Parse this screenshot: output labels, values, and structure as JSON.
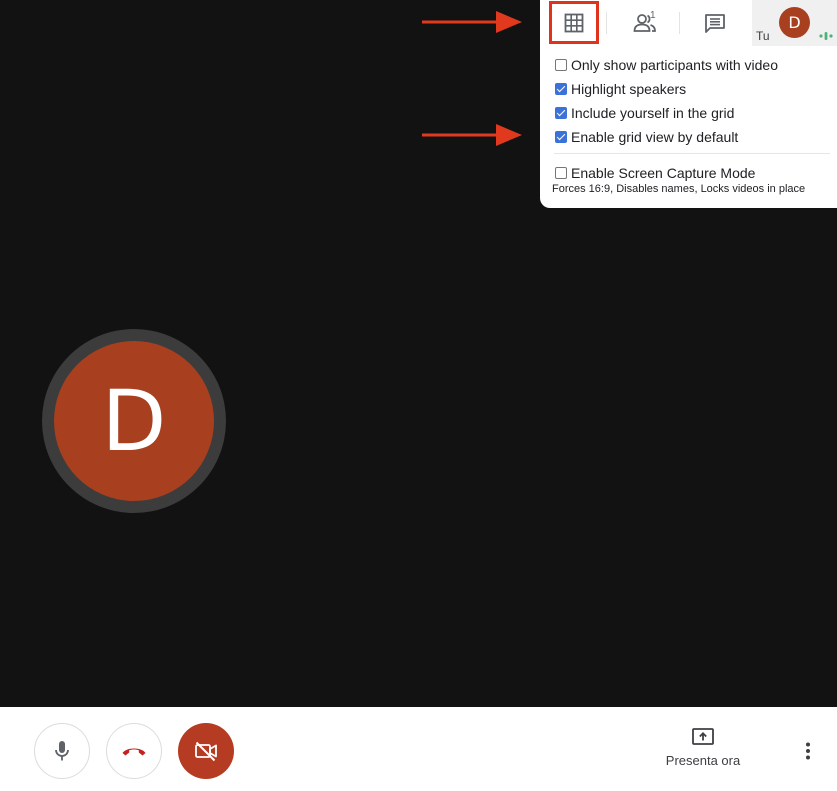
{
  "participant": {
    "initial": "D"
  },
  "panel": {
    "tabs": {
      "people_count": "1",
      "self_initial": "D",
      "self_label": "Tu"
    },
    "options": [
      {
        "label": "Only show participants with video",
        "checked": false
      },
      {
        "label": "Highlight speakers",
        "checked": true
      },
      {
        "label": "Include yourself in the grid",
        "checked": true
      },
      {
        "label": "Enable grid view by default",
        "checked": true
      }
    ],
    "capture": {
      "label": "Enable Screen Capture Mode",
      "checked": false,
      "note": "Forces 16:9, Disables names, Locks videos in place"
    }
  },
  "toolbar": {
    "present_label": "Presenta ora"
  },
  "colors": {
    "background": "#121212",
    "avatar": "#a8401f",
    "highlight": "#e0331c",
    "checkbox": "#3b72d9",
    "camera_off": "#b53b22",
    "hangup": "#c5221f",
    "audio_level": "#1e8e3e"
  },
  "icons": [
    "grid-icon",
    "people-icon",
    "chat-icon",
    "audio-level-icon",
    "mic-icon",
    "hangup-icon",
    "camera-off-icon",
    "present-screen-icon",
    "more-vert-icon",
    "arrow-icon"
  ]
}
